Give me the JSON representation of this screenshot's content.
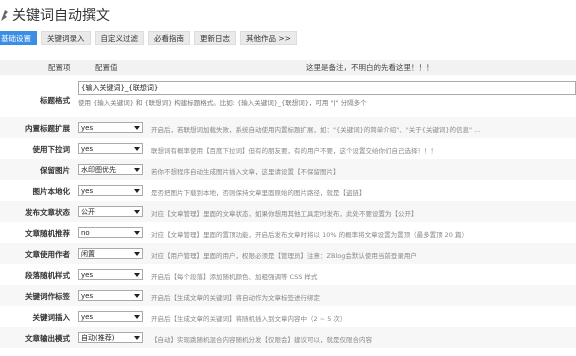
{
  "app": {
    "title": "关键词自动撰文"
  },
  "tabs": [
    {
      "label": "基础设置"
    },
    {
      "label": "关键词录入"
    },
    {
      "label": "自定义过滤"
    },
    {
      "label": "必看指南"
    },
    {
      "label": "更新日志"
    },
    {
      "label": "其他作品 >>"
    }
  ],
  "table_header": {
    "col1": "配置项",
    "col2": "配置值",
    "col3": "这里是备注，不明白的先看这里！！！"
  },
  "title_format": {
    "label": "标题格式",
    "value": "{输入关键词}_{联想词}",
    "help": "使用 {输入关键词} 和 {联想词} 构建标题格式。比如: {输入关键词}_{联想词}，可用 \"|\" 分隔多个"
  },
  "settings": [
    {
      "label": "内置标题扩展",
      "value": "yes",
      "desc": "开启后，若联想词加载失败，系统自动使用内置标题扩展，如：\"{关键词}的简单介绍\"、\"关于{关键词}的信息\" ..."
    },
    {
      "label": "使用下拉词",
      "value": "yes",
      "desc": "联想词有概率使用【百度下拉词】但有的朋友要，有的用户不要，这个设置交给你们自己选择！！！"
    },
    {
      "label": "保留图片",
      "value": "水印图优先",
      "desc": "若你不想程序自动生成图片插入文章，这里请设置【不保留图片】"
    },
    {
      "label": "图片本地化",
      "value": "yes",
      "desc": "是否把图片下载到本地，否则保持文章里面原始的图片路径，就是【盗链】"
    },
    {
      "label": "发布文章状态",
      "value": "公开",
      "desc": "对应【文章管理】里面的文章状态，如果你想用其他工具定时发布，此处不要设置为【公开】"
    },
    {
      "label": "文章随机推荐",
      "value": "no",
      "desc": "对应【文章管理】里面的置顶功能，开启后发布文章时将以 10% 的概率将文章设置为置顶（最多置顶 20 篇）"
    },
    {
      "label": "文章使用作者",
      "value": "闲置",
      "desc": "对应【用户管理】里面的用户，权限必须是【管理员】注意：ZBlog会默认使用当前登录用户"
    },
    {
      "label": "段落随机样式",
      "value": "yes",
      "desc": "开启后【每个段落】添加随机颜色、加粗强调等 CSS 样式"
    },
    {
      "label": "关键词作标签",
      "value": "yes",
      "desc": "开启后【生成文章的关键词】将自动作为文章标签进行绑定"
    },
    {
      "label": "关键词插入",
      "value": "yes",
      "desc": "开启后【生成文章的关键词】将随机插入到文章内容中（2 ~ 5 次）"
    },
    {
      "label": "文章输出模式",
      "value": "自动(推荐)",
      "desc": "【自动】实现跳随机混合内容随机分发【仅限会】建议可以，就是仅限合内容"
    }
  ],
  "colors": {
    "accent": "#3a8ee6",
    "header_bg": "#f2f2f2",
    "row_shade": "#f7f7f7"
  },
  "icons": {
    "app": "app-logo-icon",
    "dropdown": "chevron-down-icon"
  }
}
